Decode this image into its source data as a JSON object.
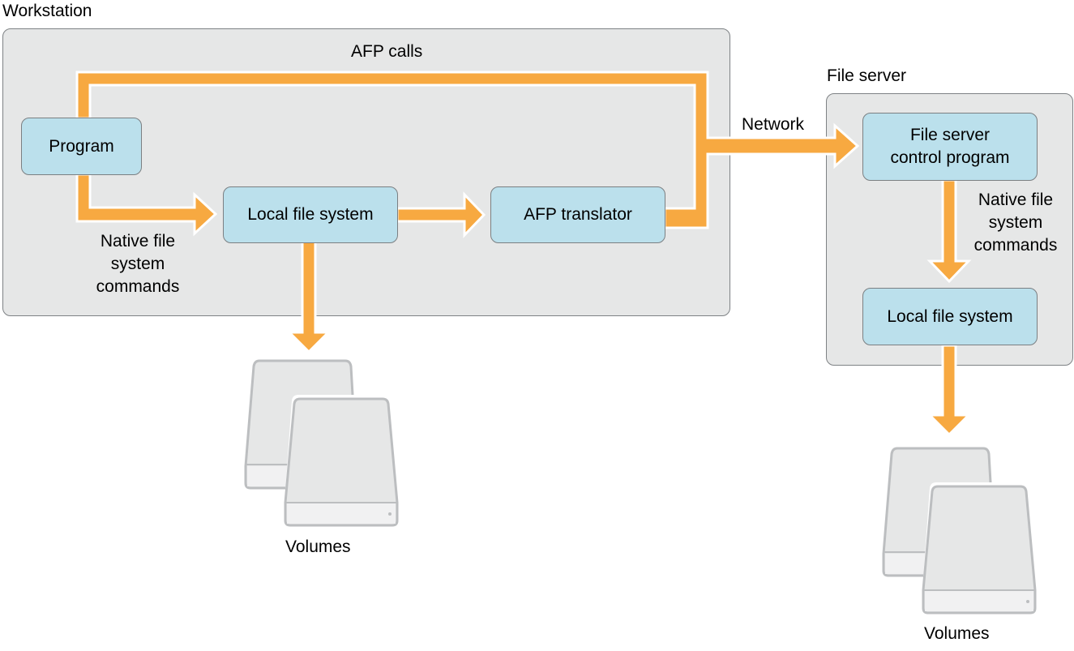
{
  "diagram": {
    "groups": {
      "workstation": {
        "label": "Workstation"
      },
      "file_server": {
        "label": "File server"
      }
    },
    "nodes": {
      "program": {
        "label": "Program"
      },
      "ws_local_fs": {
        "label": "Local file system"
      },
      "afp_translator": {
        "label": "AFP translator"
      },
      "fs_control_program": {
        "label": "File server\ncontrol program"
      },
      "fs_local_fs": {
        "label": "Local file system"
      }
    },
    "edge_labels": {
      "afp_calls": "AFP calls",
      "network": "Network",
      "ws_native_cmds": "Native file\nsystem\ncommands",
      "fs_native_cmds": "Native file\nsystem\ncommands"
    },
    "volumes": {
      "ws_volumes": {
        "label": "Volumes"
      },
      "fs_volumes": {
        "label": "Volumes"
      }
    },
    "edges": [
      {
        "from": "program",
        "to": "ws_local_fs",
        "label": "Native file system commands"
      },
      {
        "from": "program",
        "to": "fs_control_program",
        "label": "AFP calls"
      },
      {
        "from": "ws_local_fs",
        "to": "afp_translator"
      },
      {
        "from": "afp_translator",
        "to": "fs_control_program",
        "label": "Network"
      },
      {
        "from": "ws_local_fs",
        "to": "ws_volumes"
      },
      {
        "from": "fs_control_program",
        "to": "fs_local_fs",
        "label": "Native file system commands"
      },
      {
        "from": "fs_local_fs",
        "to": "fs_volumes"
      }
    ],
    "colors": {
      "arrow": "#f7a941",
      "node_fill": "#bbe0ec",
      "group_fill": "#e6e7e7",
      "border": "#7e8285"
    }
  }
}
